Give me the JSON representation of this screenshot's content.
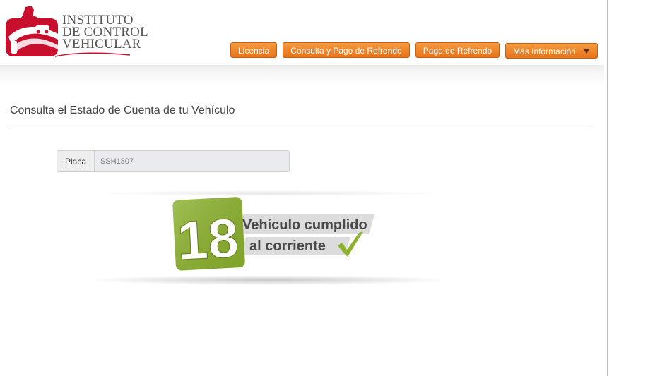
{
  "brand": {
    "name_lines": [
      "INSTITUTO",
      "DE CONTROL",
      "VEHICULAR"
    ],
    "primary_color": "#c8102e",
    "accent_color": "#e8731a"
  },
  "nav": {
    "items": [
      {
        "label": "Licencia"
      },
      {
        "label": "Consulta y Pago de Refrendo"
      },
      {
        "label": "Pago de Refrendo"
      },
      {
        "label": "Más Información",
        "has_dropdown": true
      }
    ]
  },
  "main": {
    "title": "Consulta el Estado de Cuenta de tu Vehículo",
    "placa": {
      "label": "Placa",
      "value": "SSH1807"
    },
    "status": {
      "year": "18",
      "line1": "Vehículo cumplido",
      "line2": "al corriente",
      "icon": "checkmark-icon",
      "badge_color": "#8cb22e"
    }
  }
}
